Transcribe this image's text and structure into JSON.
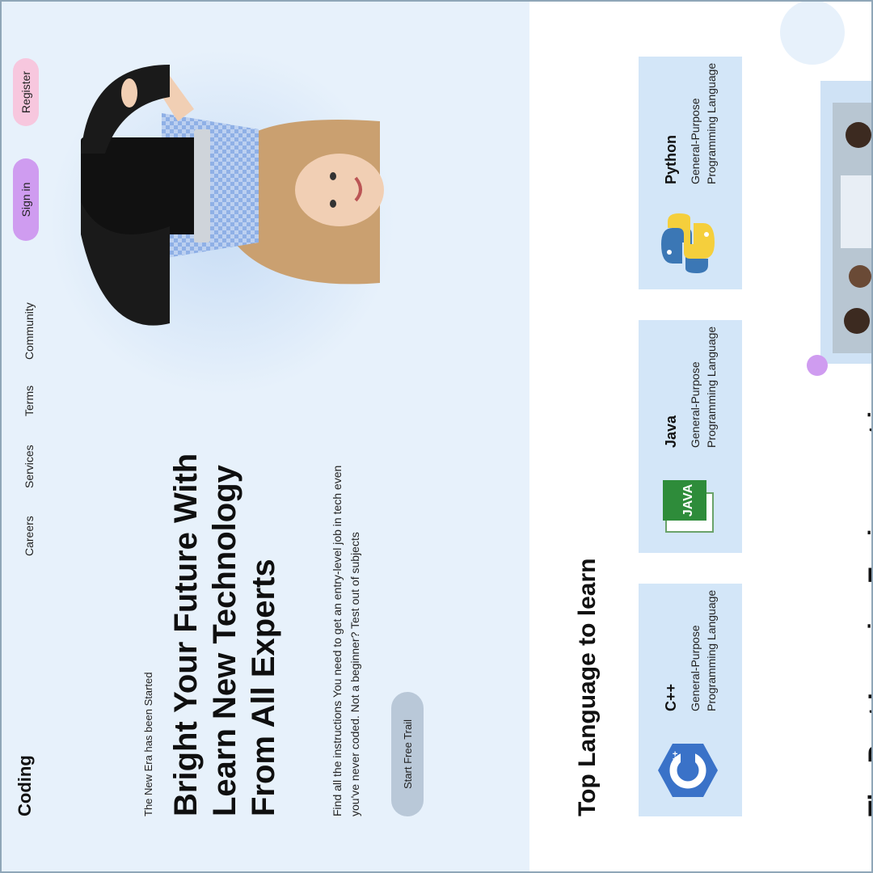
{
  "header": {
    "logo": "Coding",
    "nav": [
      "Careers",
      "Services",
      "Terms",
      "Community"
    ],
    "signin_label": "Sign in",
    "register_label": "Register"
  },
  "hero": {
    "tagline": "The New Era has been Started",
    "headline": "Bright Your Future With Learn New Technology From All Experts",
    "description": "Find all the instructions You need to get an entry-level job in tech even you've never coded. Not a beginner? Test out of subjects",
    "cta_label": "Start Free Trail"
  },
  "languages": {
    "title": "Top Language to learn",
    "items": [
      {
        "name": "C++",
        "desc": "General-Purpose Programming Language",
        "icon": "cpp-icon"
      },
      {
        "name": "Java",
        "desc": "General-Purpose Programming Language",
        "icon": "java-icon"
      },
      {
        "name": "Python",
        "desc": "General-Purpose Programming Language",
        "icon": "python-icon"
      }
    ]
  },
  "next_section": {
    "title_partial": "The Best Learning Environment is"
  },
  "colors": {
    "hero_bg": "#e7f1fb",
    "card_bg": "#d3e6f8",
    "signin": "#cf9cf0",
    "register": "#f7c7de",
    "cta": "#b9c8d8"
  }
}
